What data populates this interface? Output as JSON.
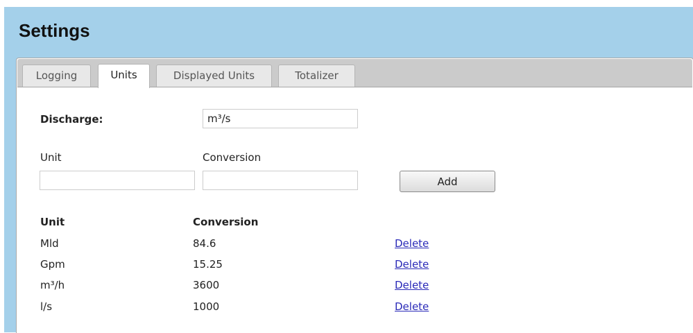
{
  "page": {
    "title": "Settings"
  },
  "tabs": [
    {
      "label": "Logging",
      "active": false
    },
    {
      "label": "Units",
      "active": true
    },
    {
      "label": "Displayed Units",
      "active": false
    },
    {
      "label": "Totalizer",
      "active": false
    }
  ],
  "form": {
    "discharge_label": "Discharge:",
    "discharge_value": "m³/s",
    "unit_label": "Unit",
    "conversion_label": "Conversion",
    "unit_value": "",
    "conversion_value": "",
    "add_label": "Add"
  },
  "units_table": {
    "headers": [
      "Unit",
      "Conversion"
    ],
    "delete_label": "Delete",
    "rows": [
      {
        "unit": "Mld",
        "conversion": "84.6"
      },
      {
        "unit": "Gpm",
        "conversion": "15.25"
      },
      {
        "unit": "m³/h",
        "conversion": "3600"
      },
      {
        "unit": "l/s",
        "conversion": "1000"
      }
    ]
  },
  "colors": {
    "header_background": "#a4d0ea",
    "tabbar_background": "#cbcbcb",
    "link": "#2a2ab8"
  }
}
